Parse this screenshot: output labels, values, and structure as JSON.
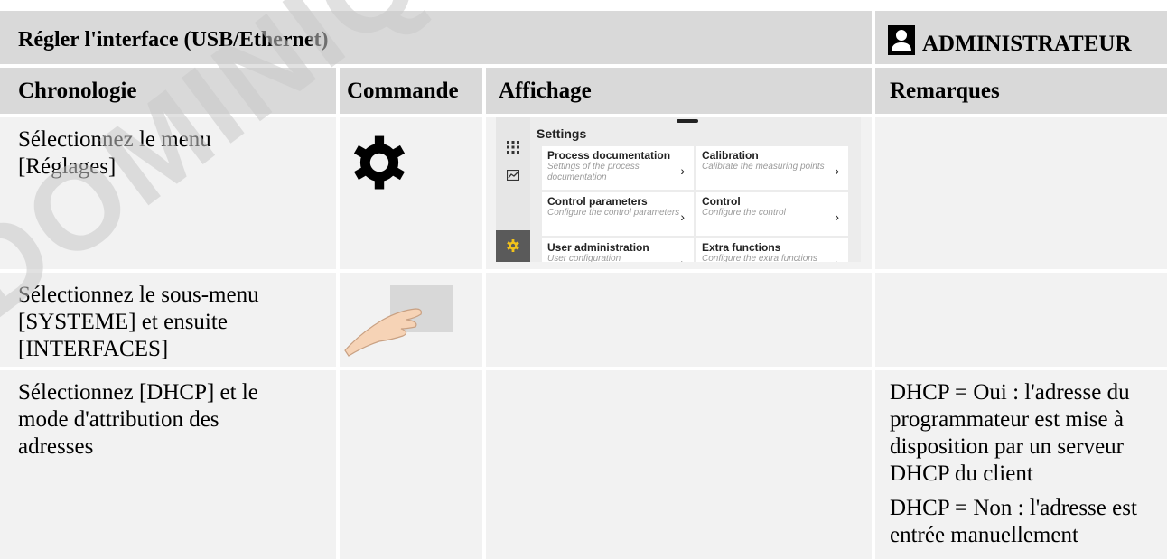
{
  "header": {
    "title": "Régler l'interface (USB/Ethernet)",
    "role": "ADMINISTRATEUR",
    "role_icon": "user-icon"
  },
  "columns": [
    "Chronologie",
    "Commande",
    "Affichage",
    "Remarques"
  ],
  "rows": [
    {
      "step": "Sélectionnez le menu [Réglages]",
      "command_icon": "gear-icon",
      "remarks": []
    },
    {
      "step": "Sélectionnez le sous-menu [SYSTEME] et ensuite [INTERFACES]",
      "command_icon": "finger-tap-icon",
      "remarks": []
    },
    {
      "step": "Sélectionnez [DHCP] et le mode d'attribution des adresses",
      "command_icon": "",
      "remarks": [
        "DHCP = Oui : l'adresse du programmateur est mise à disposition par un serveur DHCP du client",
        "DHCP = Non : l'adresse est entrée manuellement"
      ]
    }
  ],
  "settings_screen": {
    "title": "Settings",
    "tiles": [
      {
        "title": "Process documentation",
        "subtitle": "Settings of the process documentation"
      },
      {
        "title": "Calibration",
        "subtitle": "Calibrate the measuring points"
      },
      {
        "title": "Control parameters",
        "subtitle": "Configure the control parameters"
      },
      {
        "title": "Control",
        "subtitle": "Configure the control"
      },
      {
        "title": "User administration",
        "subtitle": "User configuration"
      },
      {
        "title": "Extra functions",
        "subtitle": "Configure the extra functions"
      }
    ],
    "sidebar_icons": [
      "grid-icon",
      "chart-icon",
      "gear-icon"
    ]
  },
  "watermark": "DOMINIQUE",
  "colors": {
    "header_bg": "#d9d9d9",
    "cell_bg": "#f2f2f2",
    "active_icon": "#f2c21b"
  }
}
